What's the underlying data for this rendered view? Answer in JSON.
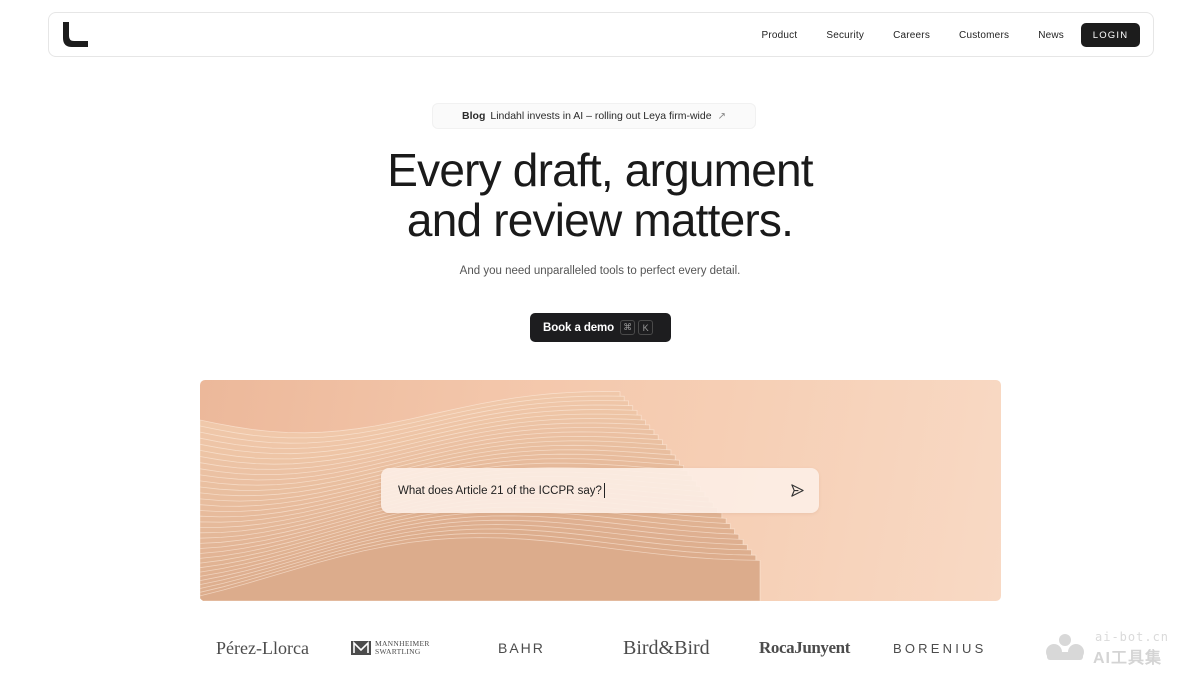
{
  "nav": {
    "items": [
      {
        "label": "Product"
      },
      {
        "label": "Security"
      },
      {
        "label": "Careers"
      },
      {
        "label": "Customers"
      },
      {
        "label": "News"
      }
    ],
    "login_label": "LOGIN"
  },
  "announcement": {
    "tag": "Blog",
    "text": "Lindahl invests in AI – rolling out Leya firm-wide",
    "arrow": "↗"
  },
  "hero": {
    "title_line1": "Every draft, argument",
    "title_line2": "and review matters.",
    "subtitle": "And you need unparalleled tools to perfect every detail.",
    "cta_label": "Book a demo",
    "shortcut_keys": [
      "⌘",
      "K"
    ]
  },
  "prompt": {
    "value": "What does Article 21 of the ICCPR say?",
    "send_icon": "send-icon"
  },
  "clients": [
    {
      "name": "Pérez-Llorca"
    },
    {
      "name_line1": "MANNHEIMER",
      "name_line2": "SWARTLING"
    },
    {
      "name": "BAHR"
    },
    {
      "name": "Bird&Bird"
    },
    {
      "name": "RocaJunyent"
    },
    {
      "name": "BORENIUS"
    }
  ],
  "watermark": {
    "line1": "ai-bot.cn",
    "line2": "AI工具集"
  },
  "colors": {
    "primary_dark": "#1c1c1c",
    "visual_peach": "#f3c6aa",
    "text_muted": "#555555"
  }
}
